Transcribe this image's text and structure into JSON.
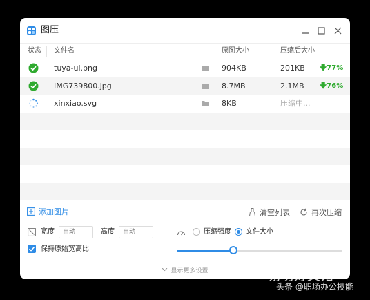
{
  "window": {
    "title": "图压"
  },
  "table": {
    "headers": {
      "status": "状态",
      "filename": "文件名",
      "original": "原图大小",
      "compressed": "压缩后大小"
    },
    "rows": [
      {
        "status": "done",
        "name": "tuya-ui.png",
        "original": "904KB",
        "compressed": "201KB",
        "reduction": "77%"
      },
      {
        "status": "done",
        "name": "IMG739800.jpg",
        "original": "8.7MB",
        "compressed": "2.1MB",
        "reduction": "76%"
      },
      {
        "status": "loading",
        "name": "xinxiao.svg",
        "original": "8KB",
        "compressed": "压缩中..."
      }
    ]
  },
  "actions": {
    "add": "添加图片",
    "clear": "清空列表",
    "recompress": "再次压缩"
  },
  "settings": {
    "width_label": "宽度",
    "width_placeholder": "自动",
    "height_label": "高度",
    "height_placeholder": "自动",
    "keep_ratio_label": "保持原始宽高比",
    "keep_ratio_checked": true,
    "mode_quality_label": "压缩强度",
    "mode_size_label": "文件大小",
    "selected_mode": "size",
    "slider_value": 0.34
  },
  "footer": {
    "more_label": "显示更多设置"
  },
  "watermark": {
    "title": "易坊好文馆",
    "subtitle": "头条 @职场办公技能"
  },
  "colors": {
    "accent": "#2f8ce6",
    "success": "#2faa2f"
  }
}
